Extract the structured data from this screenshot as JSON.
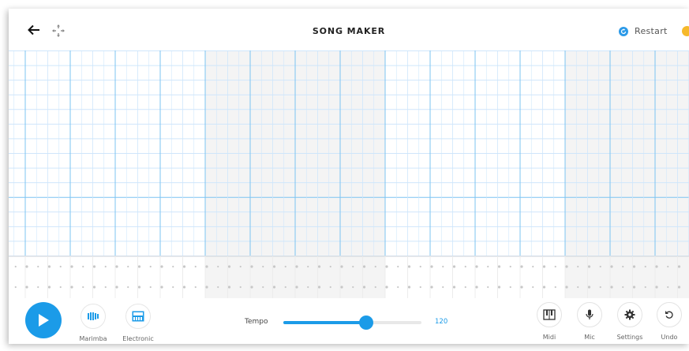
{
  "header": {
    "title": "SONG MAKER",
    "restart_label": "Restart"
  },
  "grid": {
    "melody_rows": 14,
    "beats_per_bar": 8,
    "bars": 4,
    "highlighted_bars": [
      1,
      3
    ],
    "percussion_rows": 2
  },
  "colors": {
    "accent": "#1b9be8",
    "help": "#f6b92b",
    "grid_line": "#cfe6fb",
    "bar_line": "#7cc4f2",
    "shaded_bar": "#f4f4f4"
  },
  "controls": {
    "instruments": [
      {
        "label": "Marimba",
        "icon": "marimba-icon"
      },
      {
        "label": "Electronic",
        "icon": "electronic-icon"
      }
    ],
    "tempo_label": "Tempo",
    "tempo_value": "120",
    "tempo_fraction": 0.6,
    "tools": [
      {
        "label": "Midi",
        "icon": "piano-icon"
      },
      {
        "label": "Mic",
        "icon": "mic-icon"
      },
      {
        "label": "Settings",
        "icon": "gear-icon"
      },
      {
        "label": "Undo",
        "icon": "undo-icon"
      }
    ]
  }
}
